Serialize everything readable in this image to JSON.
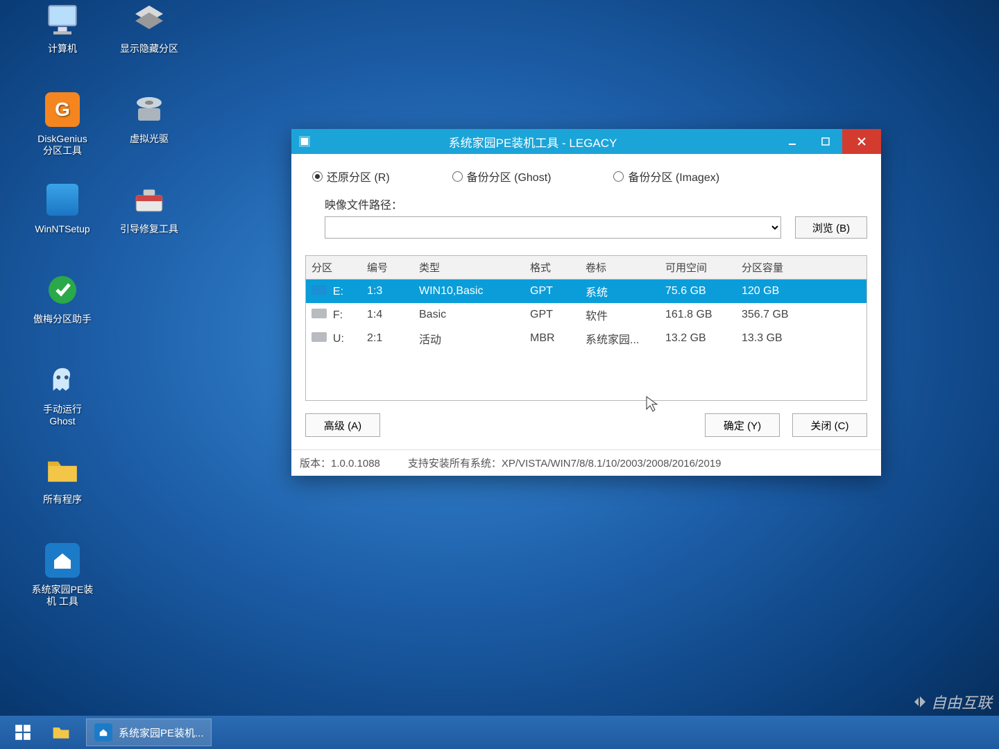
{
  "desktop": {
    "icons": [
      {
        "label": "计算机",
        "name": "computer-icon"
      },
      {
        "label": "显示隐藏分区",
        "name": "show-hidden-partition-icon"
      },
      {
        "label": "DiskGenius\n分区工具",
        "name": "diskgenius-icon"
      },
      {
        "label": "虚拟光驱",
        "name": "virtual-cd-icon"
      },
      {
        "label": "WinNTSetup",
        "name": "winntsetup-icon"
      },
      {
        "label": "引导修复工具",
        "name": "boot-repair-icon"
      },
      {
        "label": "傲梅分区助手",
        "name": "aomei-partition-icon"
      },
      {
        "label": "手动运行\nGhost",
        "name": "manual-ghost-icon"
      },
      {
        "label": "所有程序",
        "name": "all-programs-icon"
      },
      {
        "label": "系统家园PE装\n机 工具",
        "name": "pe-installer-icon"
      }
    ]
  },
  "taskbar": {
    "active_label": "系统家园PE装机..."
  },
  "window": {
    "title": "系统家园PE装机工具 - LEGACY",
    "radios": {
      "restore": "还原分区 (R)",
      "backup_ghost": "备份分区 (Ghost)",
      "backup_imagex": "备份分区 (Imagex)"
    },
    "image_path_label": "映像文件路径：",
    "image_path_value": "",
    "browse_label": "浏览 (B)",
    "table": {
      "headers": {
        "partition": "分区",
        "number": "编号",
        "type": "类型",
        "format": "格式",
        "label": "卷标",
        "free": "可用空间",
        "capacity": "分区容量"
      },
      "rows": [
        {
          "partition": "E:",
          "number": "1:3",
          "type": "WIN10,Basic",
          "format": "GPT",
          "label": "系统",
          "free": "75.6 GB",
          "capacity": "120 GB",
          "selected": true
        },
        {
          "partition": "F:",
          "number": "1:4",
          "type": "Basic",
          "format": "GPT",
          "label": "软件",
          "free": "161.8 GB",
          "capacity": "356.7 GB",
          "selected": false
        },
        {
          "partition": "U:",
          "number": "2:1",
          "type": "活动",
          "format": "MBR",
          "label": "系统家园...",
          "free": "13.2 GB",
          "capacity": "13.3 GB",
          "selected": false
        }
      ]
    },
    "buttons": {
      "advanced": "高级 (A)",
      "ok": "确定 (Y)",
      "close": "关闭 (C)"
    },
    "footer": {
      "version": "版本：1.0.0.1088",
      "support": "支持安装所有系统：XP/VISTA/WIN7/8/8.1/10/2003/2008/2016/2019"
    }
  },
  "watermark": "自由互联"
}
